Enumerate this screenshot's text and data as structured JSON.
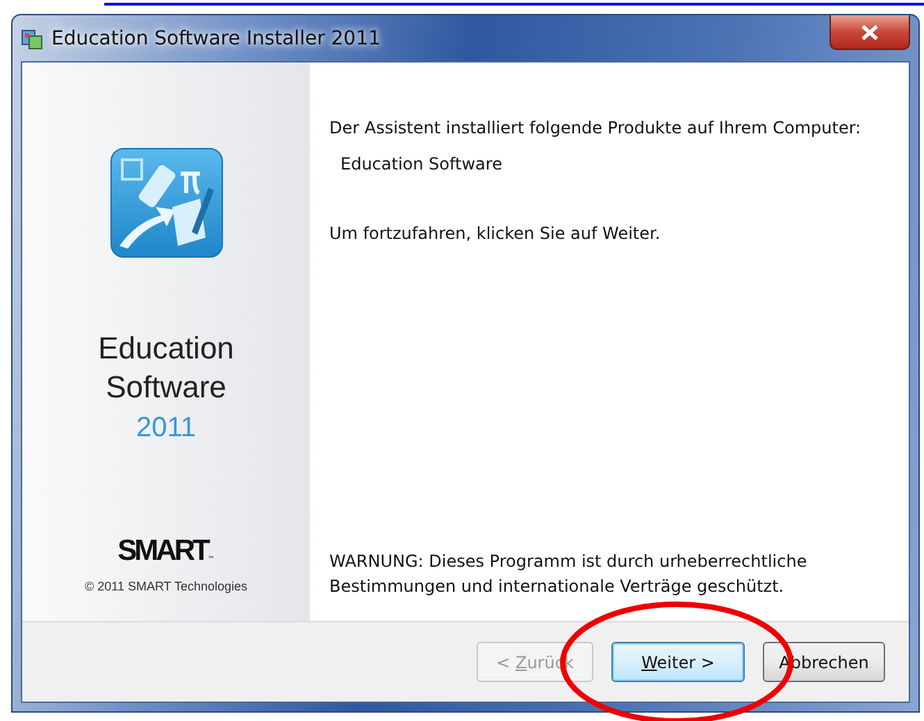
{
  "window": {
    "title": "Education Software Installer 2011"
  },
  "sidebar": {
    "product_line1": "Education",
    "product_line2": "Software",
    "year": "2011",
    "brand": "SMART",
    "brand_mark": "™",
    "copyright": "© 2011 SMART Technologies"
  },
  "content": {
    "intro": "Der Assistent installiert folgende Produkte auf Ihrem Computer:",
    "product": "Education Software",
    "instruction": "Um fortzufahren, klicken Sie auf Weiter.",
    "warning": "WARNUNG: Dieses Programm ist durch urheberrechtliche Bestimmungen und internationale Verträge geschützt."
  },
  "buttons": [
    {
      "label": "< Zurück",
      "disabled": true,
      "focused": false,
      "mnemonic": true
    },
    {
      "label": "Weiter >",
      "disabled": false,
      "focused": true,
      "mnemonic": true
    },
    {
      "label": "Abbrechen",
      "disabled": false,
      "focused": false,
      "mnemonic": false
    }
  ]
}
